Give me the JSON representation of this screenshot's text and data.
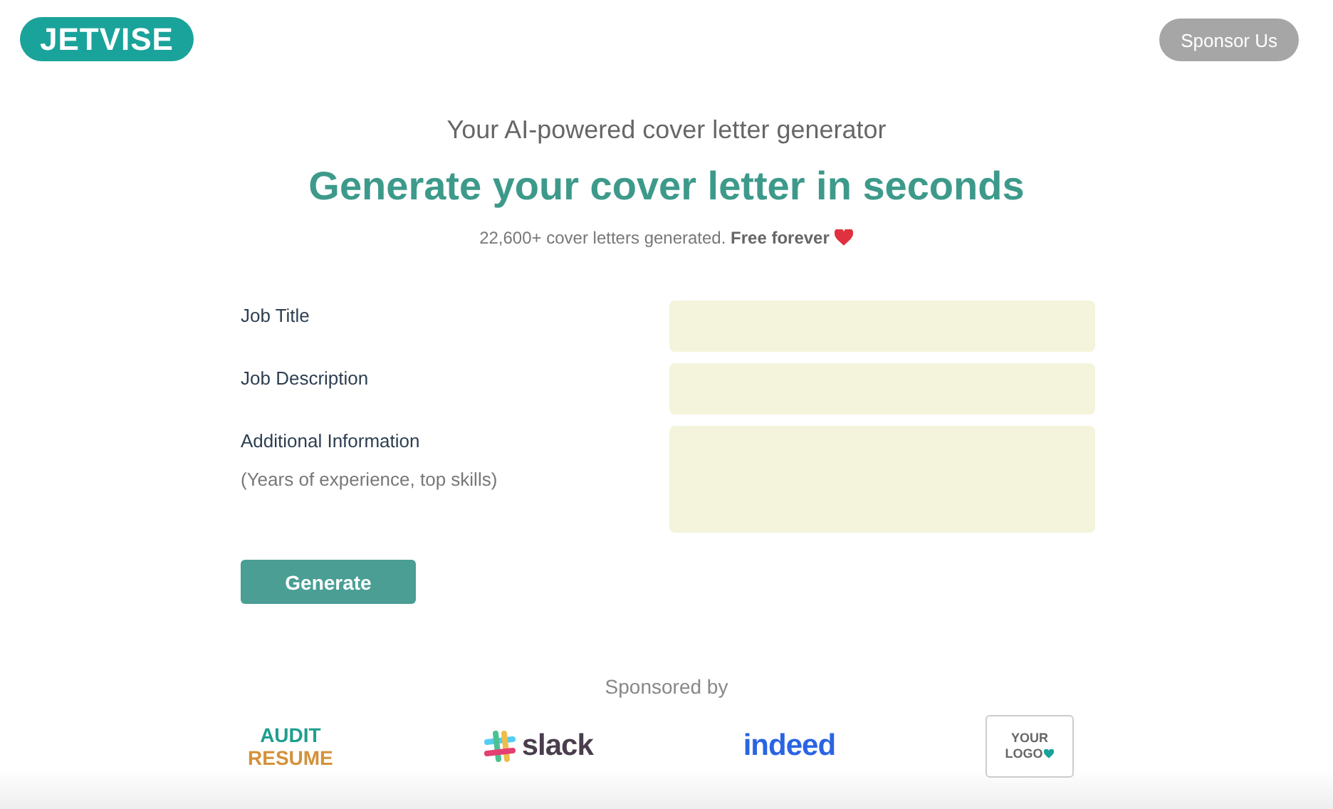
{
  "header": {
    "logo": "JETVISE",
    "sponsor_button": "Sponsor Us"
  },
  "hero": {
    "subtitle": "Your AI-powered cover letter generator",
    "title": "Generate your cover letter in seconds",
    "stats": "22,600+ cover letters generated. **Free forever**"
  },
  "form": {
    "fields": [
      {
        "label": "Job Title",
        "kind": "input"
      },
      {
        "label": "Job Description",
        "kind": "input"
      },
      {
        "label": "Additional Information",
        "hint": "(Years of experience, top skills)",
        "kind": "textarea"
      }
    ],
    "submit": "Generate"
  },
  "sponsors": {
    "heading": "Sponsored by",
    "logos": [
      {
        "kind": "stacked",
        "lines": [
          "AUDIT",
          "RESUME"
        ]
      },
      {
        "kind": "slack",
        "text": "slack"
      },
      {
        "kind": "indeed",
        "text": "indeed"
      },
      {
        "kind": "placeholder",
        "lines": [
          "YOUR",
          "LOGO"
        ]
      }
    ]
  }
}
